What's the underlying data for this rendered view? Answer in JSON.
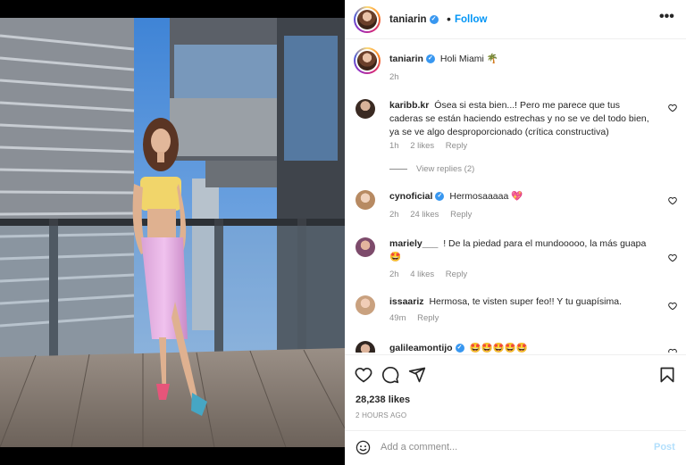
{
  "post": {
    "author": "taniarin",
    "follow_label": "Follow",
    "dot": "•",
    "more_label": "•••"
  },
  "caption": {
    "username": "taniarin",
    "text": "Holi Miami 🌴",
    "time": "2h"
  },
  "comments": [
    {
      "username": "karibb.kr",
      "text": "Ósea si esta bien...! Pero me parece que tus caderas se están haciendo estrechas y no se ve del todo bien, ya se ve algo desproporcionado (crítica constructiva)",
      "time": "1h",
      "likes": "2 likes",
      "reply": "Reply",
      "verified": false
    },
    {
      "username": "cynoficial",
      "text": "Hermosaaaaa 💖",
      "time": "2h",
      "likes": "24 likes",
      "reply": "Reply",
      "verified": true
    },
    {
      "username": "mariely___",
      "text": "! De la piedad para el mundooooo, la más guapa 🤩",
      "time": "2h",
      "likes": "4 likes",
      "reply": "Reply",
      "verified": false
    },
    {
      "username": "issaariz",
      "text": "Hermosa, te visten super feo!! Y tu guapísima.",
      "time": "49m",
      "likes": "",
      "reply": "Reply",
      "verified": false
    },
    {
      "username": "galileamontijo",
      "text": "🤩🤩🤩🤩🤩",
      "time": "",
      "likes": "",
      "reply": "",
      "verified": true
    }
  ],
  "view_replies": "View replies (2)",
  "likes_count": "28,238 likes",
  "posted_ago": "2 HOURS AGO",
  "comment_box": {
    "placeholder": "Add a comment...",
    "post_label": "Post"
  },
  "icons": {
    "like": "heart-icon",
    "comment": "comment-icon",
    "share": "share-icon",
    "save": "bookmark-icon",
    "emoji": "emoji-icon",
    "more": "more-options-icon",
    "verified": "verified-badge-icon"
  },
  "colors": {
    "link_blue": "#0095f6",
    "verified_blue": "#3897f0",
    "muted": "#8e8e8e",
    "post_disabled": "#b2dffc"
  }
}
